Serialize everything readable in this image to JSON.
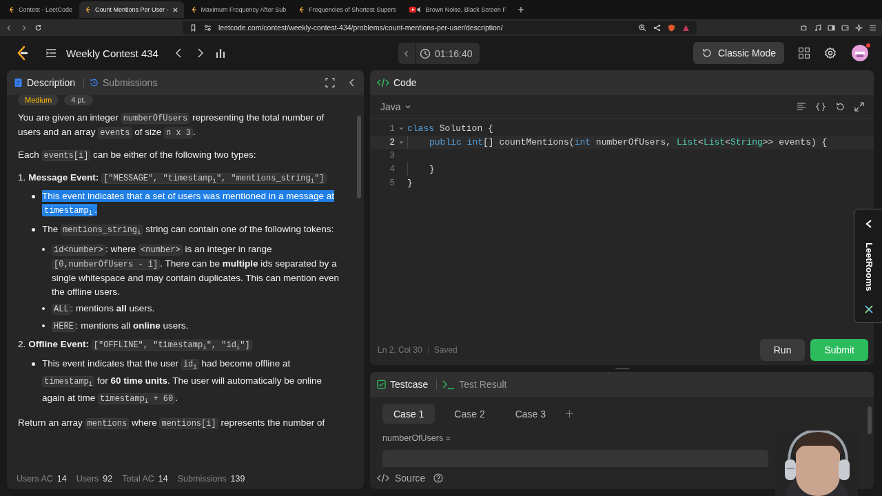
{
  "browser": {
    "tabs": [
      {
        "title": "Contest - LeetCode",
        "selected": false,
        "kind": "site"
      },
      {
        "title": "Count Mentions Per User - ",
        "selected": true,
        "kind": "site"
      },
      {
        "title": "Maximum Frequency After Sub",
        "selected": false,
        "kind": "site"
      },
      {
        "title": "Frequencies of Shortest Supers",
        "selected": false,
        "kind": "site"
      },
      {
        "title": "Brown Noise, Black Screen F",
        "selected": false,
        "kind": "video"
      }
    ],
    "url": "leetcode.com/contest/weekly-contest-434/problems/count-mentions-per-user/description/"
  },
  "nav": {
    "title": "Weekly Contest 434",
    "timer": "01:16:40",
    "mode_button": "Classic Mode"
  },
  "description": {
    "tabs": [
      {
        "label": "Description",
        "selected": true
      },
      {
        "label": "Submissions",
        "selected": false
      }
    ],
    "tags": [
      {
        "kind": "difficulty",
        "text": "Medium"
      },
      {
        "kind": "points",
        "text": "4 pt."
      }
    ],
    "blocks": [
      {
        "kind": "para",
        "segments": [
          {
            "kind": "text",
            "text": "You are given an integer "
          },
          {
            "kind": "code",
            "text": "numberOfUsers"
          },
          {
            "kind": "text",
            "text": " representing the total number of users and an array "
          },
          {
            "kind": "code",
            "text": "events"
          },
          {
            "kind": "text",
            "text": " of size "
          },
          {
            "kind": "code",
            "text": "n x 3"
          },
          {
            "kind": "text",
            "text": "."
          }
        ]
      },
      {
        "kind": "para",
        "segments": [
          {
            "kind": "text",
            "text": "Each "
          },
          {
            "kind": "code",
            "text": "events[i]"
          },
          {
            "kind": "text",
            "text": " can be either of the following two types:"
          }
        ]
      },
      {
        "kind": "ordered",
        "items": [
          {
            "marker": "1.",
            "segments": [
              {
                "kind": "text",
                "text": "**Message Event:** "
              },
              {
                "kind": "code",
                "text": "[\"MESSAGE\", \"timestamp$_{i}$\", \"mentions_string$_{i}$\"]"
              }
            ],
            "children": [
              {
                "highlighted": true,
                "segments": [
                  {
                    "kind": "text",
                    "text": "This event indicates that a set of users was mentioned in a message at "
                  },
                  {
                    "kind": "code",
                    "text": "timestamp$_{i}$"
                  },
                  {
                    "kind": "text",
                    "text": "."
                  }
                ]
              },
              {
                "highlighted": false,
                "segments": [
                  {
                    "kind": "text",
                    "text": "The "
                  },
                  {
                    "kind": "code",
                    "text": "mentions_string$_{i}$"
                  },
                  {
                    "kind": "text",
                    "text": " string can contain one of the following tokens:"
                  }
                ],
                "children": [
                  {
                    "highlighted": false,
                    "segments": [
                      {
                        "kind": "code",
                        "text": "id<number>"
                      },
                      {
                        "kind": "text",
                        "text": ": where "
                      },
                      {
                        "kind": "code",
                        "text": "<number>"
                      },
                      {
                        "kind": "text",
                        "text": " is an integer in range "
                      },
                      {
                        "kind": "code",
                        "text": "[0,numberOfUsers - 1]"
                      },
                      {
                        "kind": "text",
                        "text": ". There can be **multiple** ids separated by a single whitespace and may contain duplicates. This can mention even the offline users."
                      }
                    ]
                  },
                  {
                    "highlighted": false,
                    "segments": [
                      {
                        "kind": "code",
                        "text": "ALL"
                      },
                      {
                        "kind": "text",
                        "text": ": mentions **all** users."
                      }
                    ]
                  },
                  {
                    "highlighted": false,
                    "segments": [
                      {
                        "kind": "code",
                        "text": "HERE"
                      },
                      {
                        "kind": "text",
                        "text": ": mentions all **online** users."
                      }
                    ]
                  }
                ]
              }
            ]
          },
          {
            "marker": "2.",
            "segments": [
              {
                "kind": "text",
                "text": "**Offline Event:** "
              },
              {
                "kind": "code",
                "text": "[\"OFFLINE\", \"timestamp$_{i}$\", \"id$_{i}$\"]"
              }
            ],
            "children": [
              {
                "highlighted": false,
                "segments": [
                  {
                    "kind": "text",
                    "text": "This event indicates that the user "
                  },
                  {
                    "kind": "code",
                    "text": "id$_{i}$"
                  },
                  {
                    "kind": "text",
                    "text": " had become offline at "
                  },
                  {
                    "kind": "code",
                    "text": "timestamp$_{i}$"
                  },
                  {
                    "kind": "text",
                    "text": " for **60 time units**. The user will automatically be online again at time "
                  },
                  {
                    "kind": "code",
                    "text": "timestamp$_{i}$ + 60"
                  },
                  {
                    "kind": "text",
                    "text": "."
                  }
                ]
              }
            ]
          }
        ]
      },
      {
        "kind": "para",
        "segments": [
          {
            "kind": "text",
            "text": "Return an array "
          },
          {
            "kind": "code",
            "text": "mentions"
          },
          {
            "kind": "text",
            "text": " where "
          },
          {
            "kind": "code",
            "text": "mentions[i]"
          },
          {
            "kind": "text",
            "text": " represents the number of"
          }
        ]
      }
    ],
    "stats": [
      {
        "label": "Users AC",
        "value": "14"
      },
      {
        "label": "Users",
        "value": "92"
      },
      {
        "label": "Total AC",
        "value": "14"
      },
      {
        "label": "Submissions",
        "value": "139"
      }
    ]
  },
  "code": {
    "title": "Code",
    "language": "Java",
    "lines": [
      {
        "number": "1",
        "fold": true,
        "active": false,
        "indented": false,
        "tokens": [
          {
            "kind": "keyword",
            "text": "class "
          },
          {
            "kind": "plain",
            "text": "Solution {"
          }
        ]
      },
      {
        "number": "2",
        "fold": true,
        "active": true,
        "indented": true,
        "tokens": [
          {
            "kind": "keyword",
            "text": "public int"
          },
          {
            "kind": "plain",
            "text": "[] countMentions("
          },
          {
            "kind": "keyword",
            "text": "int "
          },
          {
            "kind": "plain",
            "text": "numberOfUsers, "
          },
          {
            "kind": "type",
            "text": "List"
          },
          {
            "kind": "plain",
            "text": "<"
          },
          {
            "kind": "type",
            "text": "List"
          },
          {
            "kind": "plain",
            "text": "<"
          },
          {
            "kind": "type",
            "text": "String"
          },
          {
            "kind": "plain",
            "text": ">> events) {"
          }
        ]
      },
      {
        "number": "3",
        "fold": false,
        "active": false,
        "indented": false
      },
      {
        "number": "4",
        "fold": false,
        "active": false,
        "indented": true,
        "tokens": [
          {
            "kind": "plain",
            "text": "}"
          }
        ]
      },
      {
        "number": "5",
        "fold": false,
        "active": false,
        "indented": false,
        "tokens": [
          {
            "kind": "plain",
            "text": "}"
          }
        ]
      }
    ],
    "position": "Ln 2, Col 30",
    "save_state": "Saved",
    "run": "Run",
    "submit": "Submit"
  },
  "testcase": {
    "tabs": [
      {
        "label": "Testcase",
        "selected": true
      },
      {
        "label": "Test Result",
        "selected": false
      }
    ],
    "cases": [
      {
        "label": "Case 1",
        "selected": true
      },
      {
        "label": "Case 2",
        "selected": false
      },
      {
        "label": "Case 3",
        "selected": false
      }
    ],
    "param_label": "numberOfUsers =",
    "source": "Source"
  },
  "side_tab": {
    "label": "LeetRooms"
  }
}
